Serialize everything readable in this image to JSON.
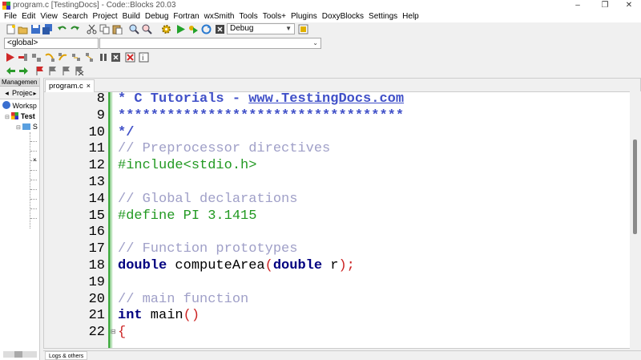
{
  "window": {
    "title": "program.c [TestingDocs] - Code::Blocks 20.03",
    "controls": [
      "–",
      "❐",
      "✕"
    ]
  },
  "menu": [
    "File",
    "Edit",
    "View",
    "Search",
    "Project",
    "Build",
    "Debug",
    "Fortran",
    "wxSmith",
    "Tools",
    "Tools+",
    "Plugins",
    "DoxyBlocks",
    "Settings",
    "Help"
  ],
  "toolbar": {
    "build_target": "Debug",
    "scope_combo": "<global>",
    "symbol_combo": ""
  },
  "management": {
    "header": "Managemen",
    "close": "×",
    "tab": "Projec",
    "tab_arrow": "▸",
    "workspace": "Worksp",
    "project": "Test",
    "folder": "S"
  },
  "editor": {
    "tab_label": "program.c",
    "tab_close": "×",
    "lines": [
      {
        "n": "8",
        "segments": [
          {
            "t": "* C Tutorials - ",
            "c": "doc"
          },
          {
            "t": "www.TestingDocs.com",
            "c": "doc u"
          }
        ]
      },
      {
        "n": "9",
        "segments": [
          {
            "t": "***********************************",
            "c": "doc"
          }
        ]
      },
      {
        "n": "10",
        "segments": [
          {
            "t": "*/",
            "c": "doc"
          }
        ]
      },
      {
        "n": "11",
        "segments": [
          {
            "t": "// Preprocessor directives",
            "c": "cmt"
          }
        ]
      },
      {
        "n": "12",
        "segments": [
          {
            "t": "#include<stdio.h>",
            "c": "pp"
          }
        ]
      },
      {
        "n": "13",
        "segments": []
      },
      {
        "n": "14",
        "segments": [
          {
            "t": "// Global declarations",
            "c": "cmt"
          }
        ]
      },
      {
        "n": "15",
        "segments": [
          {
            "t": "#define PI 3.1415",
            "c": "pp"
          }
        ]
      },
      {
        "n": "16",
        "segments": []
      },
      {
        "n": "17",
        "segments": [
          {
            "t": "// Function prototypes",
            "c": "cmt"
          }
        ]
      },
      {
        "n": "18",
        "segments": [
          {
            "t": "double",
            "c": "kw"
          },
          {
            "t": " computeArea",
            "c": "plain"
          },
          {
            "t": "(",
            "c": "punc"
          },
          {
            "t": "double",
            "c": "kw"
          },
          {
            "t": " r",
            "c": "plain"
          },
          {
            "t": ");",
            "c": "punc"
          }
        ]
      },
      {
        "n": "19",
        "segments": []
      },
      {
        "n": "20",
        "segments": [
          {
            "t": "// main function",
            "c": "cmt"
          }
        ]
      },
      {
        "n": "21",
        "segments": [
          {
            "t": "int",
            "c": "kw"
          },
          {
            "t": " main",
            "c": "plain"
          },
          {
            "t": "()",
            "c": "punc"
          }
        ]
      },
      {
        "n": "22",
        "segments": [
          {
            "t": "{",
            "c": "punc"
          }
        ]
      }
    ]
  },
  "logs": {
    "tab_label": "Logs & others"
  }
}
